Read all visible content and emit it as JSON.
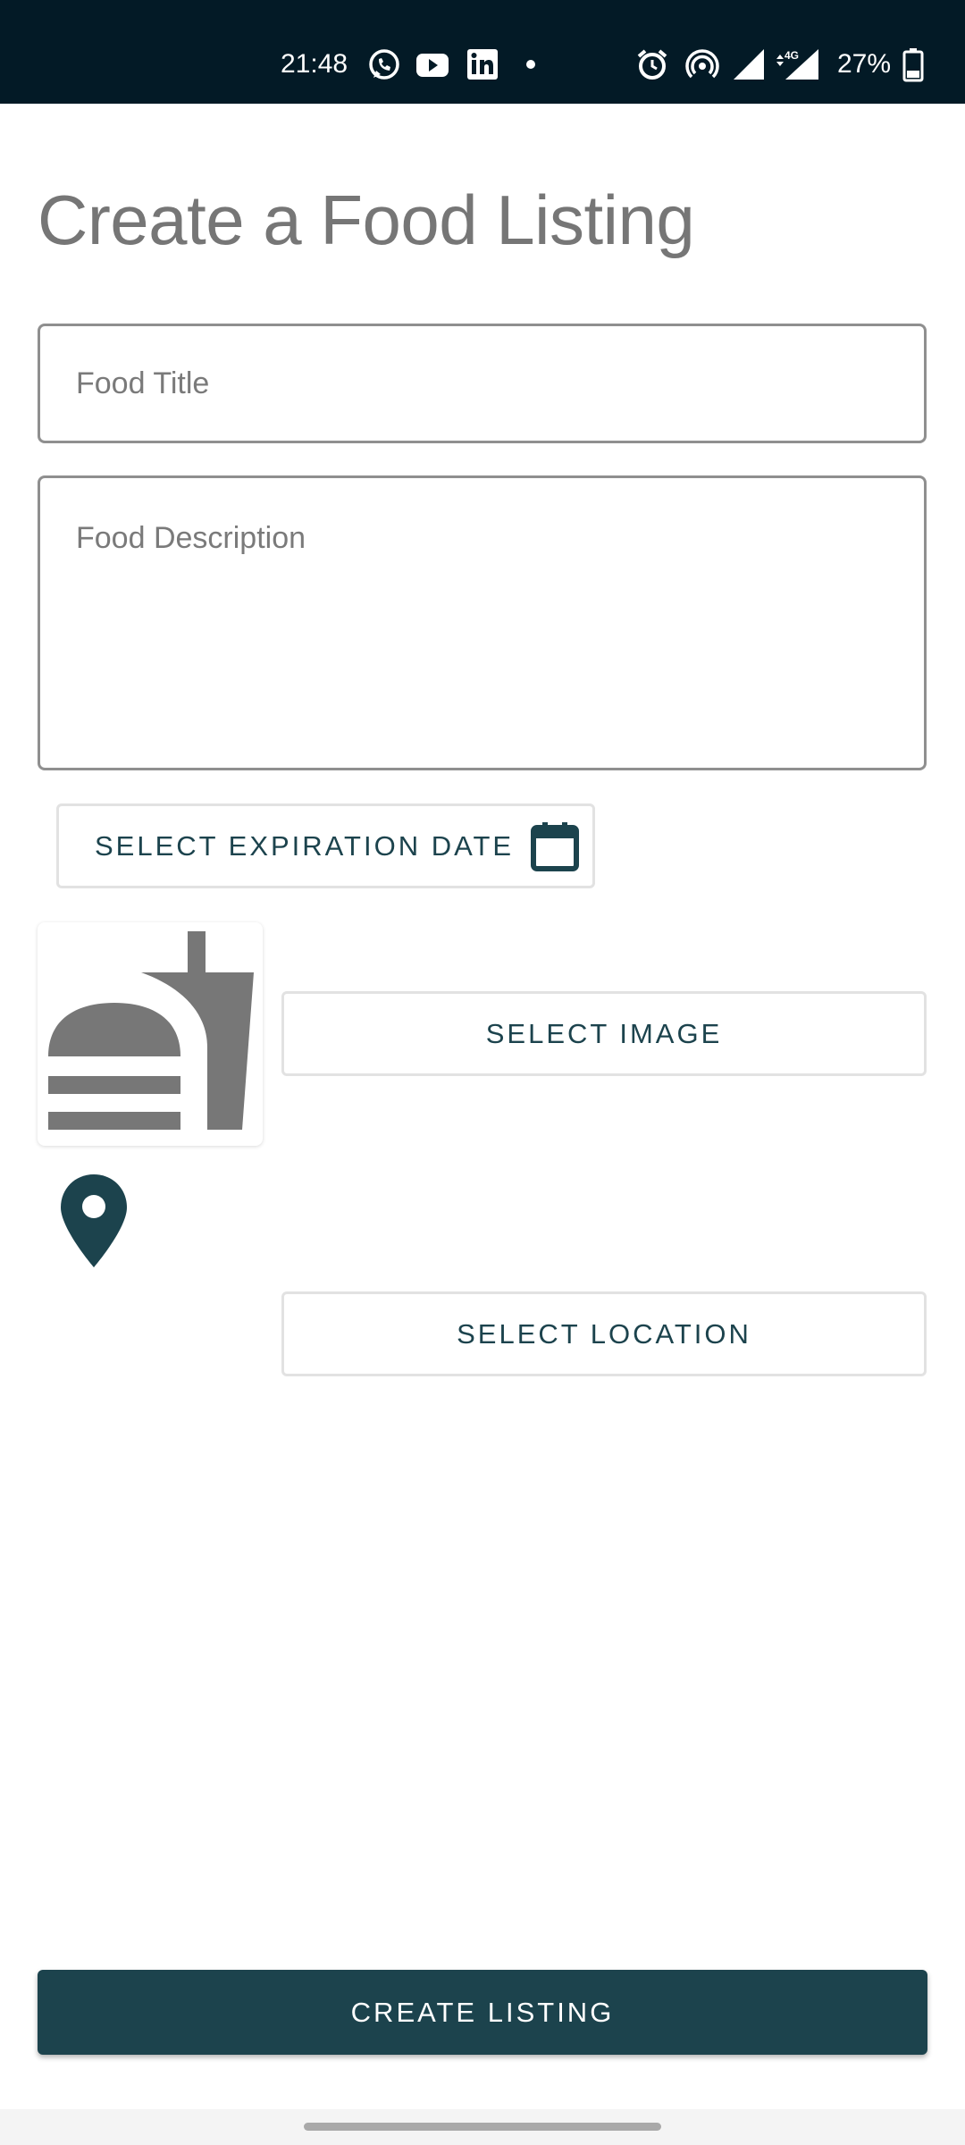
{
  "status_bar": {
    "time": "21:48",
    "battery": "27%",
    "network_label": "4G",
    "notification_icons": [
      "whatsapp-icon",
      "youtube-icon",
      "linkedin-icon",
      "dot-icon"
    ],
    "system_icons": [
      "alarm-icon",
      "hotspot-icon",
      "signal-icon",
      "signal-4g-icon",
      "battery-icon"
    ]
  },
  "page": {
    "title": "Create a Food Listing"
  },
  "form": {
    "title_placeholder": "Food Title",
    "description_placeholder": "Food Description",
    "expiration_button_label": "SELECT EXPIRATION DATE",
    "image_button_label": "SELECT IMAGE",
    "location_button_label": "SELECT LOCATION",
    "create_button_label": "CREATE LISTING"
  },
  "colors": {
    "status_bar_bg": "#031a26",
    "accent": "#1c434d",
    "title_text": "#767676",
    "placeholder_icon_gray": "#7a7a7a"
  }
}
